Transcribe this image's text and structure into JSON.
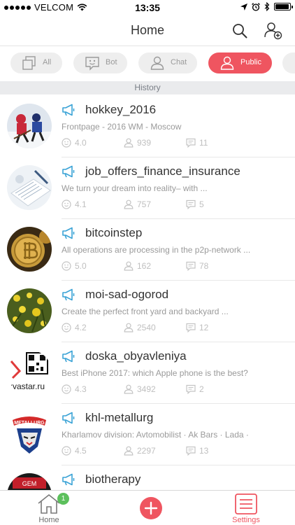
{
  "status_bar": {
    "carrier": "VELCOM",
    "time": "13:35",
    "battery_level": 0.95
  },
  "nav": {
    "title": "Home"
  },
  "filters": [
    {
      "label": "All",
      "icon": "copy-icon",
      "active": false
    },
    {
      "label": "Bot",
      "icon": "bot-face-icon",
      "active": false
    },
    {
      "label": "Chat",
      "icon": "person-icon",
      "active": false
    },
    {
      "label": "Public",
      "icon": "person-icon",
      "active": true
    }
  ],
  "history_label": "History",
  "channels": [
    {
      "title": "hokkey_2016",
      "description": "Frontpage - 2016 WM - Moscow",
      "rating": "4.0",
      "users": "939",
      "comments": "11"
    },
    {
      "title": "job_offers_finance_insurance",
      "description": "We turn your dream into reality– with ...",
      "rating": "4.1",
      "users": "757",
      "comments": "5"
    },
    {
      "title": "bitcoinstep",
      "description": " All operations are processing in the p2p-network ...",
      "rating": "5.0",
      "users": "162",
      "comments": "78"
    },
    {
      "title": "moi-sad-ogorod",
      "description": "Create the perfect front yard and backyard ...",
      "rating": "4.2",
      "users": "2540",
      "comments": "12"
    },
    {
      "title": "doska_obyavleniya",
      "description": "Best iPhone 2017: which Apple phone is the best?",
      "rating": "4.3",
      "users": "3492",
      "comments": "2",
      "avatar_caption": "kvastar.ru"
    },
    {
      "title": "khl-metallurg",
      "description": "Kharlamov division: Avtomobilist · Ak Bars · Lada ·",
      "rating": "4.5",
      "users": "2297",
      "comments": "13",
      "avatar_caption": "METALLURG"
    },
    {
      "title": "biotherapy",
      "description": "",
      "rating": "",
      "users": "",
      "comments": "",
      "avatar_caption": "GEM"
    }
  ],
  "tabs": {
    "home_label": "Home",
    "home_badge": "1",
    "settings_label": "Settings"
  },
  "colors": {
    "accent": "#ef5560",
    "megaphone": "#3aa3d6",
    "badge": "#5cc05c"
  }
}
